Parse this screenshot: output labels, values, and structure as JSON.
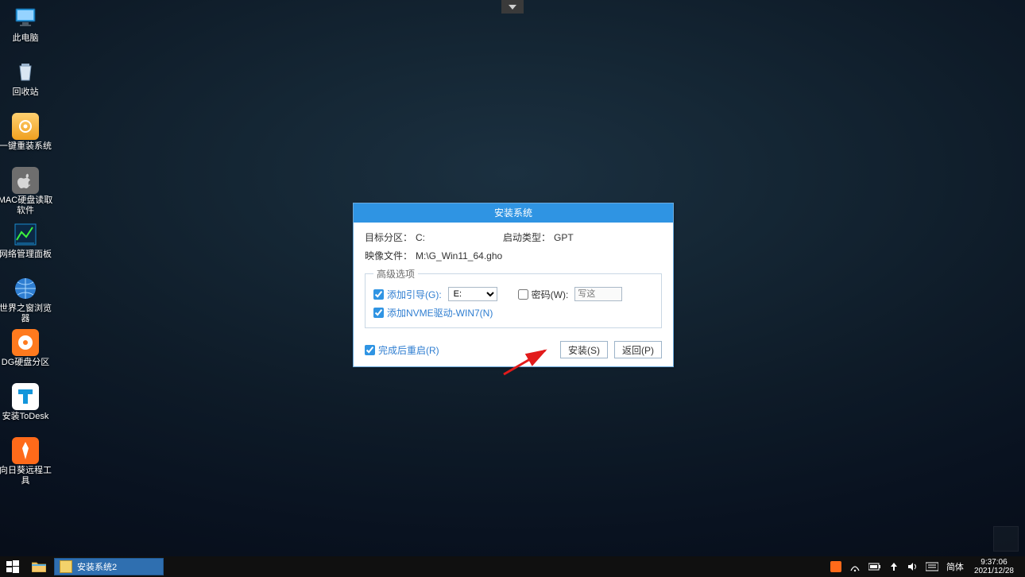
{
  "desktop_icons": [
    {
      "name": "this-pc",
      "label": "此电脑"
    },
    {
      "name": "recycle-bin",
      "label": "回收站"
    },
    {
      "name": "one-click-install",
      "label": "一键重装系统"
    },
    {
      "name": "mac-disk-reader",
      "label": "MAC硬盘读取软件"
    },
    {
      "name": "network-mgmt-panel",
      "label": "网络管理面板"
    },
    {
      "name": "world-browser",
      "label": "世界之窗浏览器"
    },
    {
      "name": "dg-partition",
      "label": "DG硬盘分区"
    },
    {
      "name": "install-todesk",
      "label": "安装ToDesk"
    },
    {
      "name": "sunflower-remote",
      "label": "向日葵远程工具"
    }
  ],
  "dialog": {
    "title": "安装系统",
    "target_label": "目标分区：",
    "target_value": "C:",
    "boot_label": "启动类型：",
    "boot_value": "GPT",
    "image_label": "映像文件：",
    "image_value": "M:\\G_Win11_64.gho",
    "adv_legend": "高级选项",
    "add_boot_label": "添加引导(G):",
    "add_boot_selected": "E:",
    "password_label": "密码(W):",
    "password_placeholder": "写这",
    "nvme_label": "添加NVME驱动-WIN7(N)",
    "restart_label": "完成后重启(R)",
    "install_btn": "安装(S)",
    "back_btn": "返回(P)"
  },
  "taskbar": {
    "task_label": "安装系统2",
    "ime": "简体",
    "time": "9:37:06",
    "date": "2021/12/28"
  }
}
